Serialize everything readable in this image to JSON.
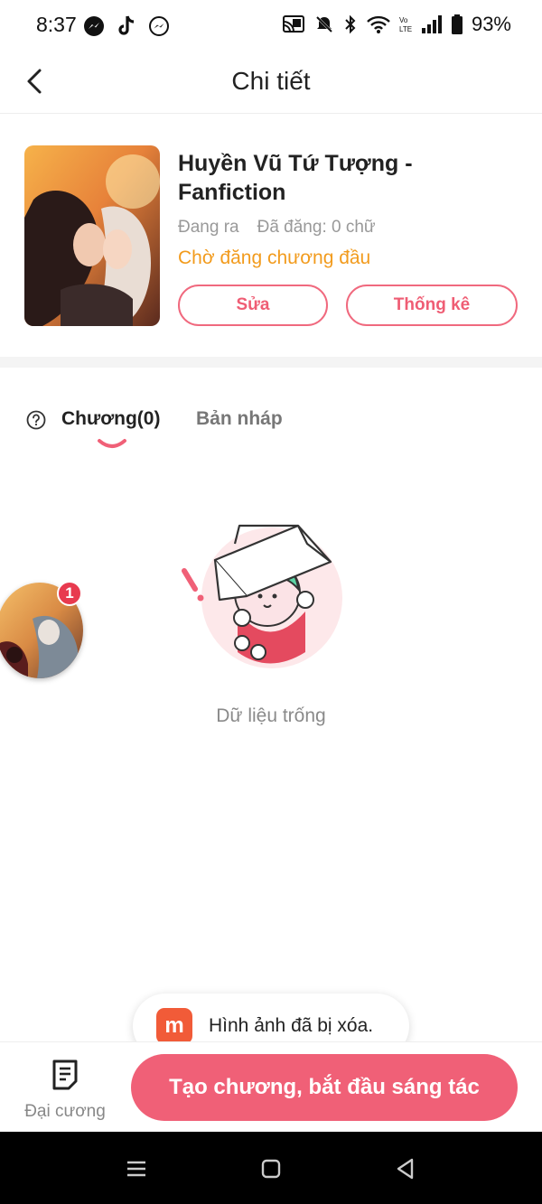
{
  "status_bar": {
    "time": "8:37",
    "battery": "93%",
    "left_icons": [
      "messenger-icon",
      "tiktok-icon",
      "messenger-icon"
    ],
    "right_icons": [
      "cast-icon",
      "mute-icon",
      "bluetooth-icon",
      "wifi-icon",
      "volte-icon",
      "signal-icon",
      "battery-icon"
    ]
  },
  "header": {
    "title": "Chi tiết",
    "back_icon": "chevron-left-icon"
  },
  "novel": {
    "title": "Huyền Vũ Tứ Tượng - Fanfiction",
    "state": "Đang ra",
    "word_count": "Đã đăng: 0 chữ",
    "publish_status": "Chờ đăng chương đầu",
    "edit_label": "Sửa",
    "stats_label": "Thống kê"
  },
  "tabs": {
    "chapters_label": "Chương(0)",
    "drafts_label": "Bản nháp",
    "help_icon": "question-circle-icon"
  },
  "empty_state": {
    "text": "Dữ liệu trống"
  },
  "floating_avatar": {
    "badge": "1"
  },
  "toast": {
    "logo": "m",
    "text": "Hình ảnh đã bị xóa."
  },
  "bottom_bar": {
    "outline_label": "Đại cương",
    "create_label": "Tạo chương, bắt đầu sáng tác"
  },
  "colors": {
    "accent": "#f06077",
    "status_orange": "#f29b1d",
    "muted_text": "#999999"
  }
}
